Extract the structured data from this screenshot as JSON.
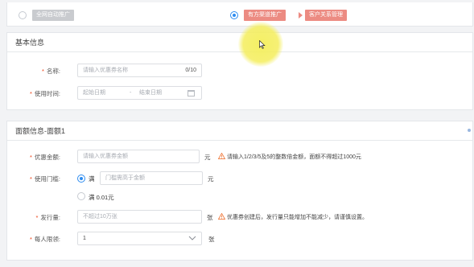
{
  "promotion": {
    "option_auto": {
      "label": "全网自动推广",
      "selected": false
    },
    "option_channel": {
      "selected": true,
      "tags": [
        "有方渠道推广",
        "客户关系管理"
      ]
    }
  },
  "basic_info": {
    "title": "基本信息",
    "name": {
      "label": "名称:",
      "placeholder": "请输入优惠券名称",
      "counter": "0/10"
    },
    "use_time": {
      "label": "使用时间:",
      "start_placeholder": "起始日期",
      "separator": "-",
      "end_placeholder": "结束日期",
      "icon": "calendar-icon"
    }
  },
  "face_value": {
    "title": "面额信息-面额1",
    "amount": {
      "label": "优惠金额:",
      "placeholder": "请输入优惠券金额",
      "unit": "元",
      "hint": "请输入1/2/3/5及5的整数倍金额，面额不得超过1000元"
    },
    "threshold": {
      "label": "使用门槛:",
      "option_full": {
        "label": "满",
        "selected": true
      },
      "threshold_placeholder": "门槛需高于金额",
      "unit": "元",
      "option_min": {
        "label": "满 0.01元",
        "selected": false
      }
    },
    "issue_count": {
      "label": "发行量:",
      "placeholder": "不超过10万张",
      "unit": "张",
      "hint": "优惠券创建后，发行量只能增加不能减少，请谨慎设置。"
    },
    "per_user_limit": {
      "label": "每人限领:",
      "value": "1",
      "unit": "张"
    }
  },
  "colors": {
    "accent": "#2d8cf0",
    "required": "#ed4014",
    "warning": "#f07b3f",
    "tag_red": "#ec8b82",
    "tag_gray": "#c9cbcf"
  }
}
